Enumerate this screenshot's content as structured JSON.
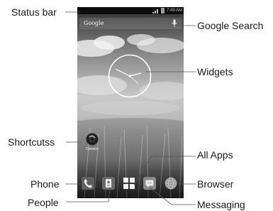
{
  "labels": {
    "status_bar": "Status bar",
    "google_search": "Google Search",
    "widgets": "Widgets",
    "shortcuts": "Shortcutss",
    "all_apps": "All Apps",
    "phone": "Phone",
    "browser": "Browser",
    "people": "People",
    "messaging": "Messaging"
  },
  "screen": {
    "status_time": "7:49 AM",
    "search_logo": "Google",
    "shortcut_label": "Camera"
  }
}
